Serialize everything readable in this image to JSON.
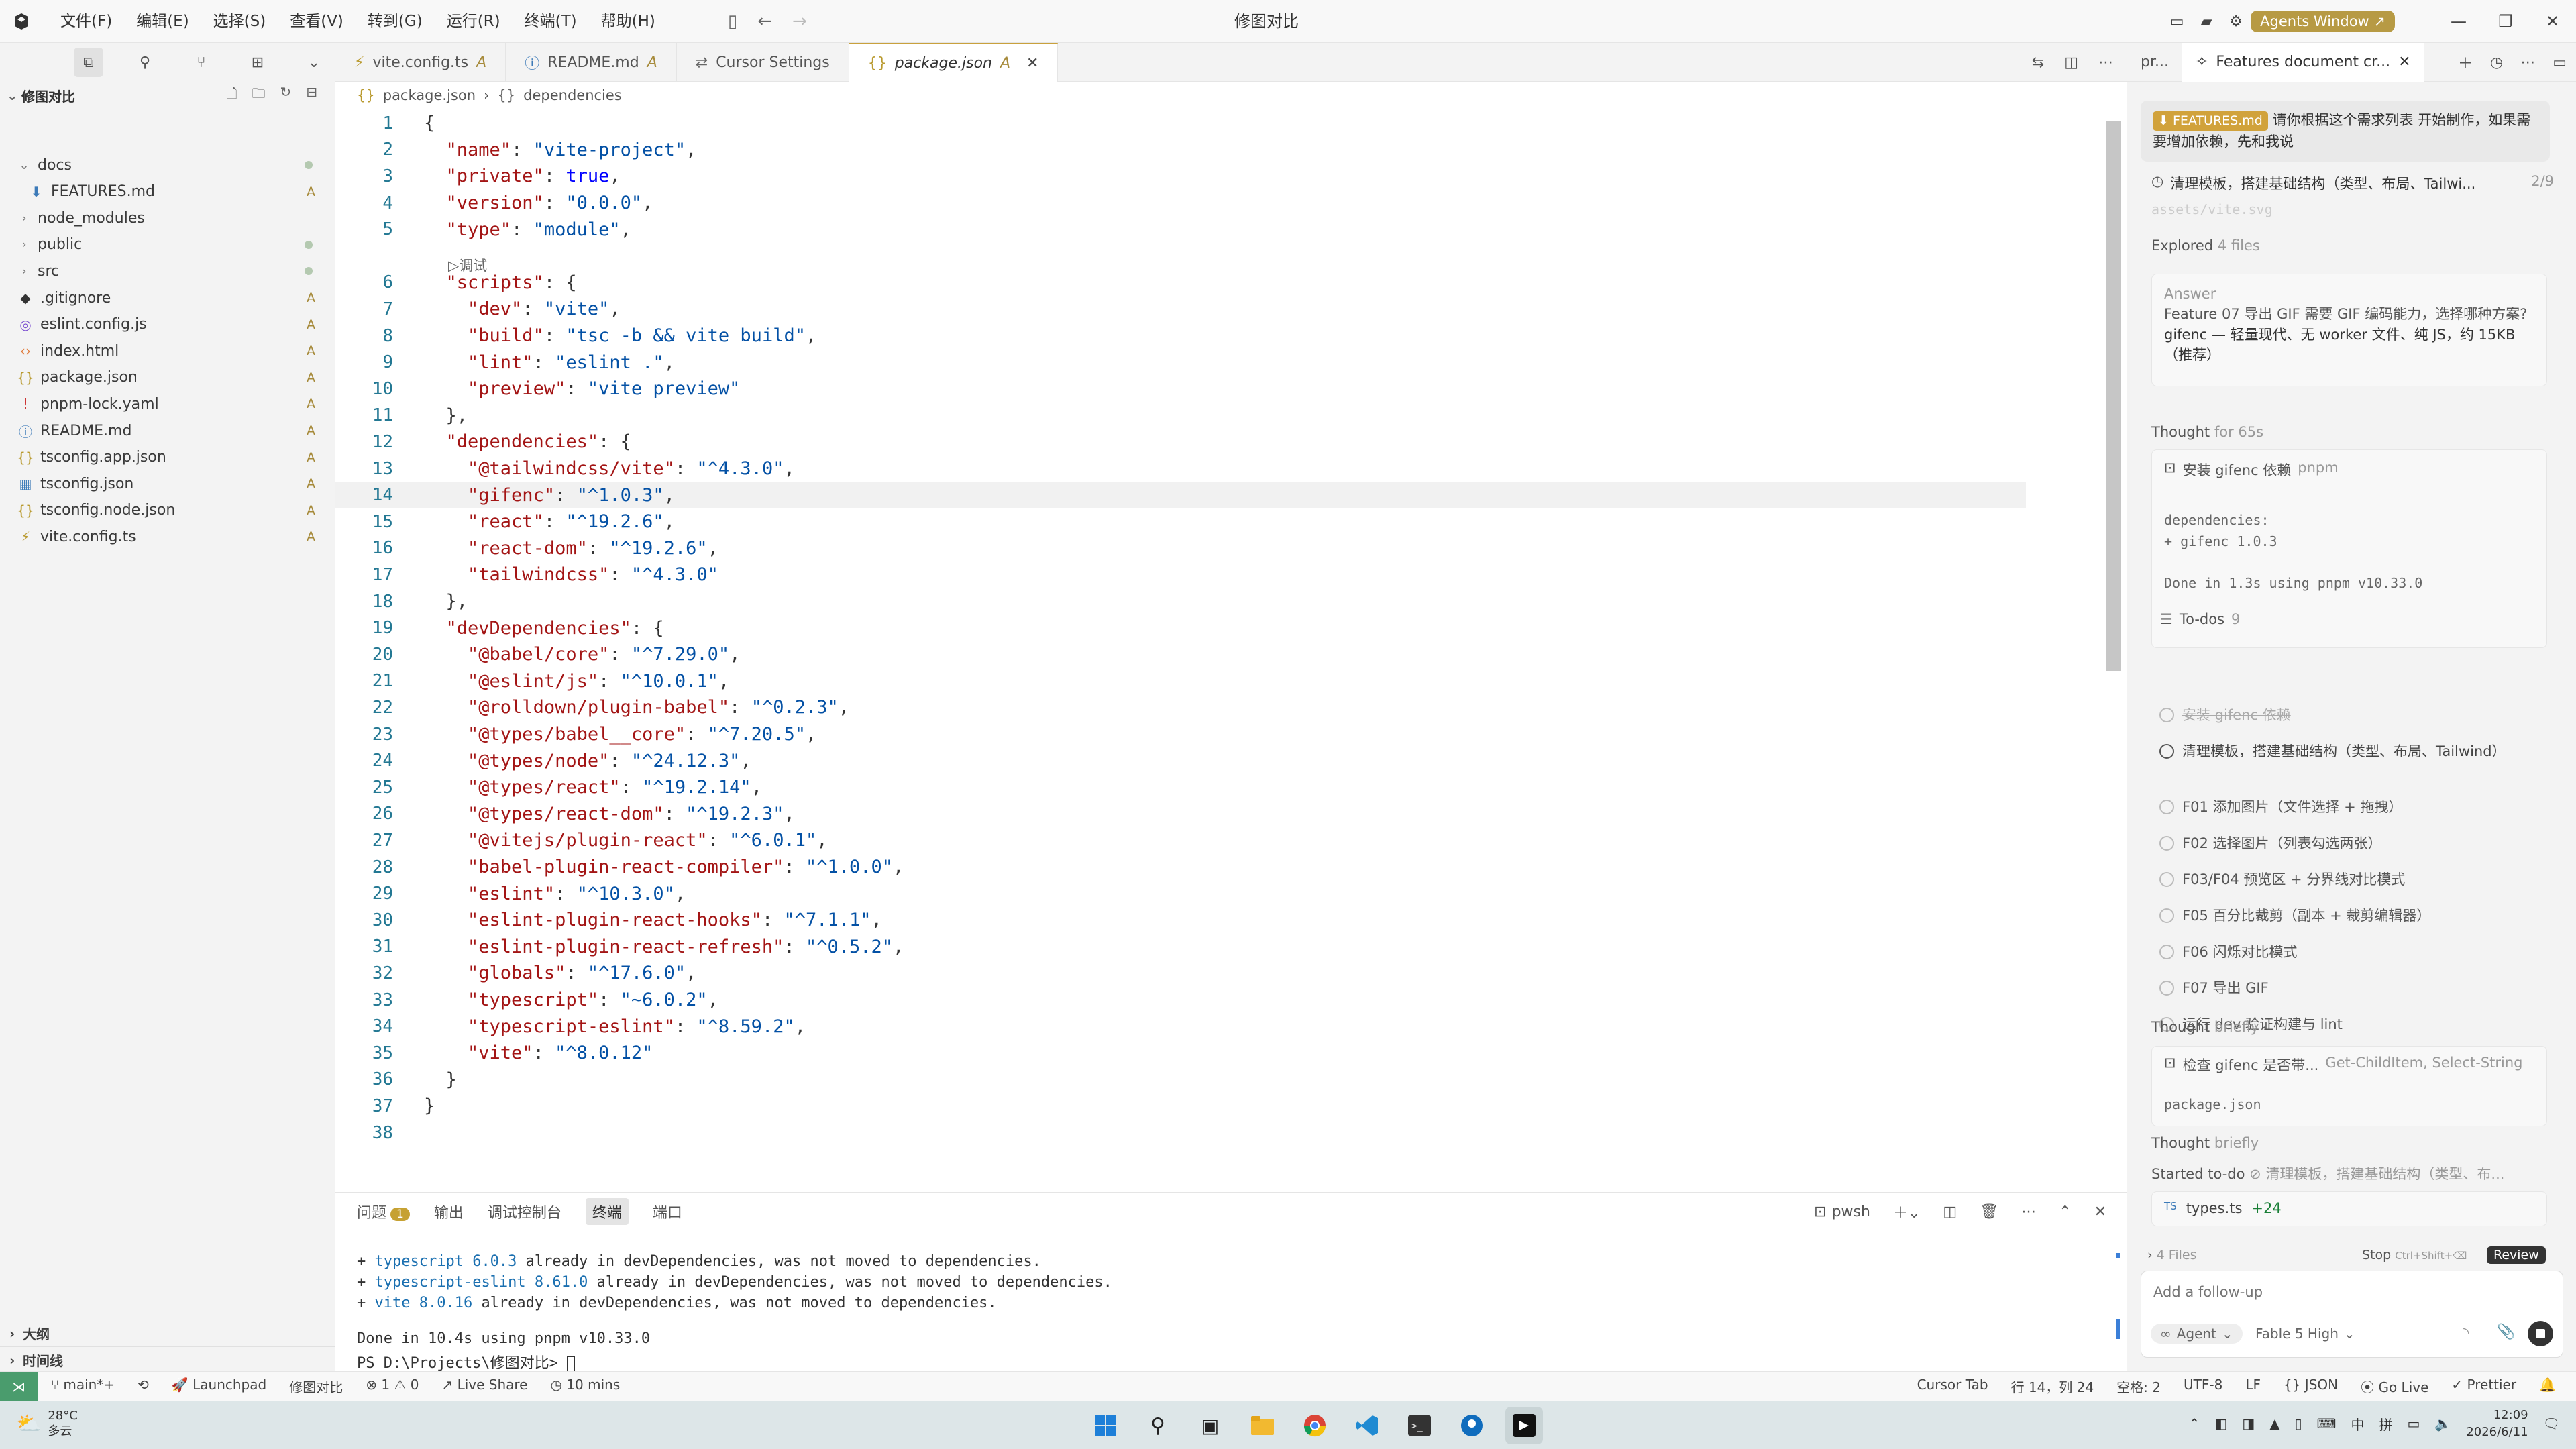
{
  "titlebar": {
    "menus": [
      "文件(F)",
      "编辑(E)",
      "选择(S)",
      "查看(V)",
      "转到(G)",
      "运行(R)",
      "终端(T)",
      "帮助(H)"
    ],
    "title": "修图对比",
    "agents_button": "Agents Window ↗"
  },
  "sidebar": {
    "project": "修图对比",
    "items": [
      {
        "label": "docs",
        "type": "folder-open",
        "mark": "dot"
      },
      {
        "label": "FEATURES.md",
        "type": "file-md",
        "mark": "A"
      },
      {
        "label": "node_modules",
        "type": "folder",
        "mark": ""
      },
      {
        "label": "public",
        "type": "folder",
        "mark": "dot"
      },
      {
        "label": "src",
        "type": "folder",
        "mark": "dot"
      },
      {
        "label": ".gitignore",
        "type": "file-git",
        "mark": "A"
      },
      {
        "label": "eslint.config.js",
        "type": "file-eslint",
        "mark": "A"
      },
      {
        "label": "index.html",
        "type": "file-html",
        "mark": "A"
      },
      {
        "label": "package.json",
        "type": "file-json",
        "mark": "A"
      },
      {
        "label": "pnpm-lock.yaml",
        "type": "file-yaml",
        "mark": "A"
      },
      {
        "label": "README.md",
        "type": "file-info",
        "mark": "A"
      },
      {
        "label": "tsconfig.app.json",
        "type": "file-json",
        "mark": "A"
      },
      {
        "label": "tsconfig.json",
        "type": "file-ts",
        "mark": "A"
      },
      {
        "label": "tsconfig.node.json",
        "type": "file-json",
        "mark": "A"
      },
      {
        "label": "vite.config.ts",
        "type": "file-vite",
        "mark": "A"
      }
    ],
    "sections": [
      "大纲",
      "时间线"
    ]
  },
  "tabs": [
    {
      "label": "vite.config.ts",
      "mark": "A",
      "icon": "vite-icon"
    },
    {
      "label": "README.md",
      "mark": "A",
      "icon": "info-icon"
    },
    {
      "label": "Cursor Settings",
      "mark": "",
      "icon": "settings-icon"
    },
    {
      "label": "package.json",
      "mark": "A",
      "icon": "json-icon",
      "active": true
    }
  ],
  "breadcrumb": [
    "package.json",
    "dependencies"
  ],
  "code_lines": [
    "{",
    "  \"name\": \"vite-project\",",
    "  \"private\": true,",
    "  \"version\": \"0.0.0\",",
    "  \"type\": \"module\",",
    "  \"scripts\": {",
    "    \"dev\": \"vite\",",
    "    \"build\": \"tsc -b && vite build\",",
    "    \"lint\": \"eslint .\",",
    "    \"preview\": \"vite preview\"",
    "  },",
    "  \"dependencies\": {",
    "    \"@tailwindcss/vite\": \"^4.3.0\",",
    "    \"gifenc\": \"^1.0.3\",",
    "    \"react\": \"^19.2.6\",",
    "    \"react-dom\": \"^19.2.6\",",
    "    \"tailwindcss\": \"^4.3.0\"",
    "  },",
    "  \"devDependencies\": {",
    "    \"@babel/core\": \"^7.29.0\",",
    "    \"@eslint/js\": \"^10.0.1\",",
    "    \"@rolldown/plugin-babel\": \"^0.2.3\",",
    "    \"@types/babel__core\": \"^7.20.5\",",
    "    \"@types/node\": \"^24.12.3\",",
    "    \"@types/react\": \"^19.2.14\",",
    "    \"@types/react-dom\": \"^19.2.3\",",
    "    \"@vitejs/plugin-react\": \"^6.0.1\",",
    "    \"babel-plugin-react-compiler\": \"^1.0.0\",",
    "    \"eslint\": \"^10.3.0\",",
    "    \"eslint-plugin-react-hooks\": \"^7.1.1\",",
    "    \"eslint-plugin-react-refresh\": \"^0.5.2\",",
    "    \"globals\": \"^17.6.0\",",
    "    \"typescript\": \"~6.0.2\",",
    "    \"typescript-eslint\": \"^8.59.2\",",
    "    \"vite\": \"^8.0.12\"",
    "  }",
    "}",
    ""
  ],
  "highlight_line": 14,
  "fold_hint": "▷调试",
  "panel": {
    "tabs": [
      "问题",
      "输出",
      "调试控制台",
      "终端",
      "端口"
    ],
    "problems_count": "1",
    "active_tab": "终端",
    "shell": "pwsh",
    "terminal_lines": [
      {
        "plus": "+ ",
        "pkg": "typescript 6.0.3",
        "rest": " already in devDependencies, was not moved to dependencies."
      },
      {
        "plus": "+ ",
        "pkg": "typescript-eslint 8.61.0",
        "rest": " already in devDependencies, was not moved to dependencies."
      },
      {
        "plus": "+ ",
        "pkg": "vite 8.0.16",
        "rest": " already in devDependencies, was not moved to dependencies."
      }
    ],
    "done_line": "Done in 10.4s using pnpm v10.33.0",
    "prompt": "PS D:\\Projects\\修图对比> "
  },
  "chat": {
    "tab_prev": "pr...",
    "tab_title": "Features document cr...",
    "user_chip": "FEATURES.md",
    "user_message": "请你根据这个需求列表 开始制作，如果需要增加依赖，先和我说",
    "progress_text": "清理模板，搭建基础结构（类型、布局、Tailwi...",
    "progress_count": "2/9",
    "faded_text": "assets/vite.svg",
    "explored": "Explored",
    "explored_files": "4 files",
    "answer_label": "Answer",
    "answer_q": "Feature 07 导出 GIF 需要 GIF 编码能力，选择哪种方案?",
    "answer_a": "gifenc — 轻量现代、无 worker 文件、纯 JS，约 15KB（推荐）",
    "thought1": "Thought",
    "thought1_time": "for 65s",
    "install_label": "安装 gifenc 依赖",
    "install_tool": "pnpm",
    "install_out1": "dependencies:",
    "install_out2": "+ gifenc 1.0.3",
    "install_out3": "Done in 1.3s using pnpm v10.33.0",
    "todos_label": "To-dos",
    "todos_count": "9",
    "todos": [
      {
        "text": "安装 gifenc 依赖",
        "state": "done"
      },
      {
        "text": "清理模板，搭建基础结构（类型、布局、Tailwind）",
        "state": "active"
      },
      {
        "text": "F01 添加图片（文件选择 + 拖拽）",
        "state": "pending"
      },
      {
        "text": "F02 选择图片（列表勾选两张）",
        "state": "pending"
      },
      {
        "text": "F03/F04 预览区 + 分界线对比模式",
        "state": "pending"
      },
      {
        "text": "F05 百分比裁剪（副本 + 裁剪编辑器）",
        "state": "pending"
      },
      {
        "text": "F06 闪烁对比模式",
        "state": "pending"
      },
      {
        "text": "F07 导出 GIF",
        "state": "pending"
      },
      {
        "text": "运行 dev 验证构建与 lint",
        "state": "pending"
      }
    ],
    "thought2": "Thought",
    "thought2_time": "briefly",
    "check_label": "检查 gifenc 是否带...",
    "check_tool": "Get-ChildItem, Select-String",
    "check_out": "package.json",
    "thought3": "Thought",
    "thought3_time": "briefly",
    "started": "Started to-do",
    "started_text": "清理模板，搭建基础结构（类型、布...",
    "file_label": "types.ts",
    "file_diff": "+24",
    "files_count": "4 Files",
    "stop": "Stop",
    "stop_hint": "Ctrl+Shift+⌫",
    "review": "Review",
    "followup_placeholder": "Add a follow-up",
    "mode": "Agent",
    "model": "Fable 5 High"
  },
  "statusbar": {
    "branch": "main*+",
    "launchpad": "Launchpad",
    "project": "修图对比",
    "errors": "1",
    "warnings": "0",
    "liveshare": "Live Share",
    "time": "10 mins",
    "cursor_tab": "Cursor Tab",
    "position": "行 14，列 24",
    "spaces": "空格: 2",
    "encoding": "UTF-8",
    "eol": "LF",
    "lang": "JSON",
    "golive": "Go Live",
    "prettier": "Prettier"
  },
  "taskbar": {
    "temp": "28°C",
    "weather": "多云",
    "ime1": "中",
    "ime2": "拼",
    "clock_time": "12:09",
    "clock_date": "2026/6/11"
  },
  "colors": {
    "accent": "#c9a13d",
    "added": "#a68a3a",
    "json_key": "#a31515",
    "json_string": "#0451a5",
    "json_bool": "#0000ff",
    "line_number": "#237893"
  }
}
